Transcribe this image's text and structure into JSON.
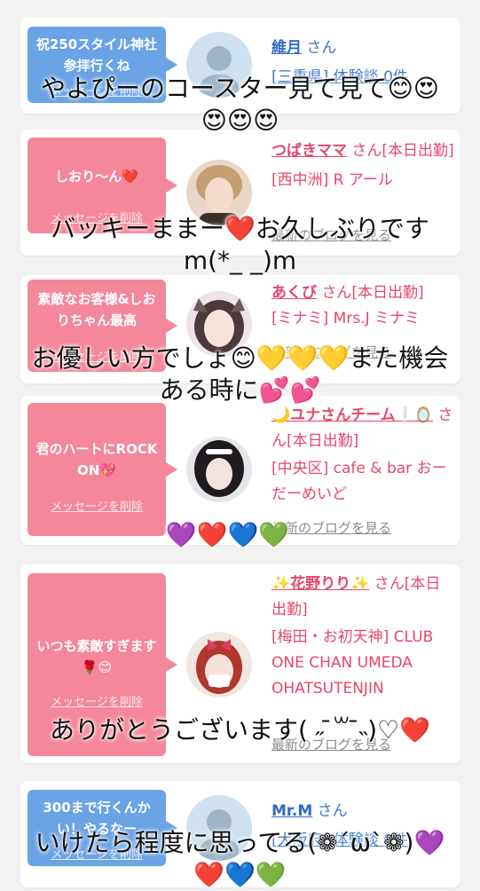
{
  "cards": [
    {
      "bubble_text": "祝250スタイル神社参拝行くね",
      "delete_label": "メッセージを削除",
      "user_name": "維月",
      "honorific": "さん",
      "location": "[三重県] 体験談 0件",
      "blog_link": "",
      "theme": "blue"
    },
    {
      "bubble_text": "しおり〜ん❤️",
      "delete_label": "メッセージを削除",
      "user_name": "つばきママ",
      "honorific": "さん[本日出勤]",
      "location": "[西中洲] R アール",
      "blog_link": "最新のブログを見る",
      "theme": "pink"
    },
    {
      "bubble_text": "素敵なお客様&しおりちゃん最高",
      "delete_label": "メッセージを削除",
      "user_name": "あくび",
      "honorific": "さん[本日出勤]",
      "location": "[ミナミ] Mrs.J ミナミ",
      "blog_link": "最新のブログを見る",
      "theme": "pink"
    },
    {
      "bubble_text": "君のハートにROCK ON💖",
      "delete_label": "メッセージを削除",
      "user_name": "🌙ユナさんチーム❕🪞",
      "honorific": "さん[本日出勤]",
      "location": "[中央区] cafe & bar おーだーめいど",
      "blog_link": "最新のブログを見る",
      "theme": "pink"
    },
    {
      "bubble_text": "いつも素敵すぎます🌹😊",
      "delete_label": "メッセージを削除",
      "user_name": "✨花野りり✨",
      "honorific": "さん[本日出勤]",
      "location": "[梅田・お初天神] CLUB ONE CHAN UMEDA OHATSUTENJIN",
      "blog_link": "最新のブログを見る",
      "theme": "pink"
    },
    {
      "bubble_text": "300まで行くんかい！やるなー",
      "delete_label": "メッセージを削除",
      "user_name": "Mr.M",
      "honorific": "さん",
      "location": "[大阪府] 体験談 0件",
      "blog_link": "",
      "theme": "blue"
    }
  ],
  "overlays": [
    {
      "line1": "やよぴーのコースター見て見て😊😍",
      "line2": "😍😍😍"
    },
    {
      "line1": "バッキーままー❤️お久しぶりです",
      "line2": "m(*_ _)m"
    },
    {
      "line1": "お優しい方でしょ😊💛💛💛また機会",
      "line2": "ある時に💕💕"
    },
    {
      "line1": "💜❤️💙💚",
      "line2": ""
    },
    {
      "line1": "ありがとうございます( ˶ ̄꒳ ̄˵)♡❤️",
      "line2": ""
    },
    {
      "line1": "いけたら程度に思ってる(❁´ω`❁)💜",
      "line2": "❤️💙💚"
    }
  ],
  "colors": {
    "bubble_pink": "#f4879a",
    "bubble_blue": "#6aa3e6",
    "name_pink": "#e6476a",
    "name_blue": "#2f6bc2",
    "background": "#f2f2f2"
  }
}
